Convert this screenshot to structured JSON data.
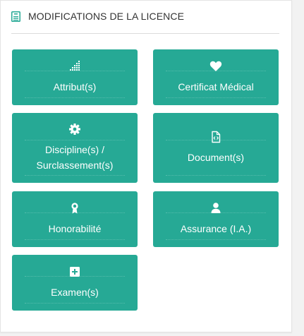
{
  "header": {
    "title": "MODIFICATIONS DE LA LICENCE",
    "icon": "id-card-icon"
  },
  "tiles": [
    {
      "label": "Attribut(s)",
      "icon": "signal-bars-icon"
    },
    {
      "label": "Certificat Médical",
      "icon": "heart-icon"
    },
    {
      "label": "Discipline(s) /\nSurclassement(s)",
      "icon": "cog-icon"
    },
    {
      "label": "Document(s)",
      "icon": "file-code-icon"
    },
    {
      "label": "Honorabilité",
      "icon": "award-ribbon-icon"
    },
    {
      "label": "Assurance (I.A.)",
      "icon": "user-icon"
    },
    {
      "label": "Examen(s)",
      "icon": "plus-square-icon"
    }
  ],
  "colors": {
    "tile_background": "#26a995",
    "header_icon": "#26a995",
    "text_on_tile": "#ffffff"
  }
}
